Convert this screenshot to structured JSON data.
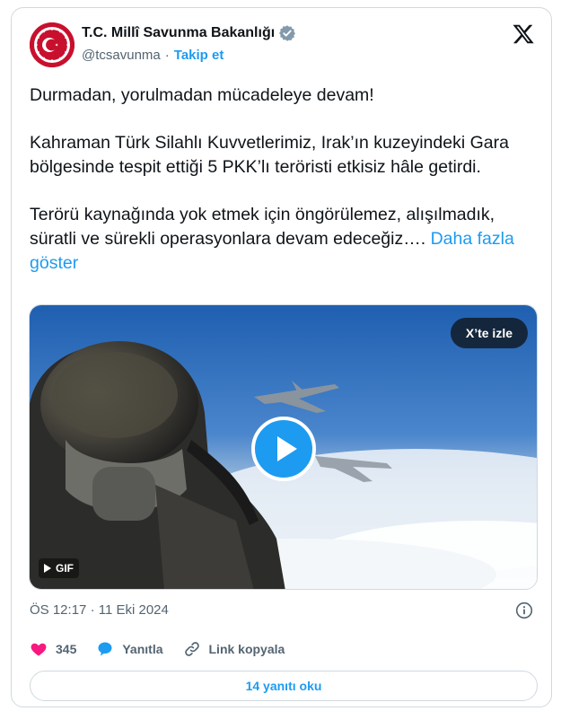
{
  "account": {
    "name": "T.C. Millî Savunma Bakanlığı",
    "handle": "@tcsavunma",
    "separator": "·",
    "follow_label": "Takip et",
    "verified_color": "#829aab"
  },
  "tweet": {
    "paragraphs": [
      "Durmadan, yorulmadan mücadeleye devam!",
      "Kahraman Türk Silahlı Kuvvetlerimiz, Irak’ın kuzeyindeki Gara bölgesinde tespit ettiği 5 PKK’lı teröristi etkisiz hâle getirdi."
    ],
    "last_paragraph": "Terörü kaynağında yok etmek için öngörülemez, alışılmadık, süratli ve sürekli operasyonlara devam edeceğiz….",
    "show_more_label": "Daha fazla göster"
  },
  "media": {
    "watch_label": "X’te izle",
    "gif_label": "GIF",
    "play_icon": "play-icon"
  },
  "meta": {
    "time": "ÖS 12:17",
    "separator": "·",
    "date": "11 Eki 2024"
  },
  "actions": {
    "like_count": "345",
    "reply_label": "Yanıtla",
    "copy_link_label": "Link kopyala"
  },
  "read_replies_label": "14 yanıtı oku",
  "colors": {
    "accent": "#1d9bf0",
    "like": "#f91880",
    "brand_red": "#c8102e",
    "text_secondary": "#536471"
  }
}
